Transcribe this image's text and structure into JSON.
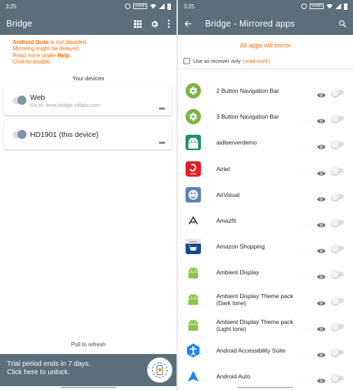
{
  "left": {
    "status": {
      "time": "3:25",
      "volte": "VoWiFi"
    },
    "appbar": {
      "title": "Bridge"
    },
    "doze": {
      "line1_bold": "Android Doze",
      "line1_rest": " is not disabled.",
      "line2": "Mirroring might be delayed.",
      "line3_pre": "Read more under ",
      "line3_bold": "Help",
      "line3_post": ".",
      "line4": "Click to disable."
    },
    "devices_header": "Your devices",
    "devices": [
      {
        "name": "Web",
        "subtitle": "Go to: www.bridge.xitlabs.com",
        "menu": "•••"
      },
      {
        "name": "HD1901 (this device)",
        "subtitle": "",
        "menu": "•••"
      }
    ],
    "pull_to_refresh": "Pull to refresh",
    "trial": {
      "line1": "Trial period ends in 7 days.",
      "line2": "Click here to unlock."
    }
  },
  "right": {
    "status": {
      "time": "3:25",
      "volte": "VoWiFi"
    },
    "appbar": {
      "title": "Bridge - Mirrored apps"
    },
    "all_apps_mirror": "All apps will mirror",
    "receiver": {
      "label": "Use as receiver only",
      "read_more": "(read more)"
    },
    "apps": [
      {
        "name": "2 Button Navigation Bar",
        "icon": "gear-icon",
        "color": "#7cb342"
      },
      {
        "name": "3 Button Navigation Bar",
        "icon": "gear-icon",
        "color": "#7cb342"
      },
      {
        "name": "aidlserverdemo",
        "icon": "android-icon",
        "color": "#1f8f6f"
      },
      {
        "name": "Airtel",
        "icon": "airtel-icon",
        "color": "#e41e26"
      },
      {
        "name": "AirVisual",
        "icon": "airvisual-icon",
        "color": "#5b82b5"
      },
      {
        "name": "Amazfit",
        "icon": "amazfit-icon",
        "color": "#222222"
      },
      {
        "name": "Amazon Shopping",
        "icon": "amazon-icon",
        "color": "#1a4a8c"
      },
      {
        "name": "Ambient Display",
        "icon": "android-icon",
        "color": "#8bc34a"
      },
      {
        "name": "Ambient Display Theme pack",
        "name2": "(Dark tone)",
        "icon": "android-icon",
        "color": "#8bc34a"
      },
      {
        "name": "Ambient Display Theme pack",
        "name2": "(Light tone)",
        "icon": "android-icon",
        "color": "#8bc34a"
      },
      {
        "name": "Android Accessibility Suite",
        "icon": "accessibility-icon",
        "color": "#1e88e5"
      },
      {
        "name": "Android Auto",
        "icon": "android-auto-icon",
        "color": "#1e88e5"
      }
    ]
  },
  "colors": {
    "primary": "#5a6e7c",
    "accent": "#ff6d00"
  }
}
